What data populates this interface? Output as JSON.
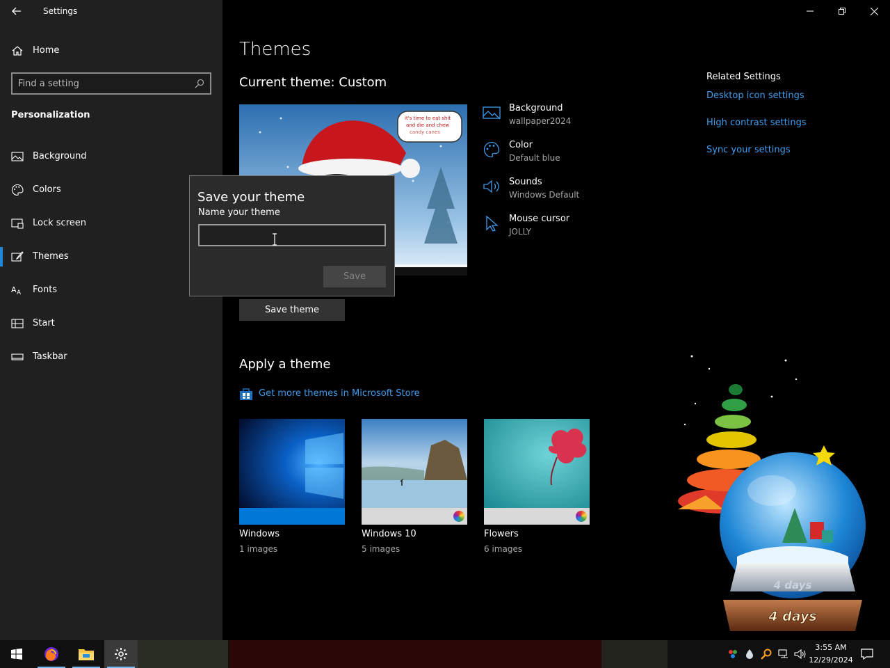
{
  "window": {
    "app_title": "Settings",
    "minimize_icon": "minimize-icon",
    "restore_icon": "restore-icon",
    "close_icon": "close-icon"
  },
  "sidebar": {
    "home_label": "Home",
    "search_placeholder": "Find a setting",
    "section_title": "Personalization",
    "items": [
      {
        "label": "Background",
        "icon": "picture-icon"
      },
      {
        "label": "Colors",
        "icon": "palette-icon"
      },
      {
        "label": "Lock screen",
        "icon": "lock-screen-icon"
      },
      {
        "label": "Themes",
        "icon": "brush-icon",
        "active": true
      },
      {
        "label": "Fonts",
        "icon": "fonts-icon"
      },
      {
        "label": "Start",
        "icon": "start-icon"
      },
      {
        "label": "Taskbar",
        "icon": "taskbar-icon"
      }
    ]
  },
  "main": {
    "title": "Themes",
    "current_theme": "Current theme: Custom",
    "preview_caption": "it's time to eat shit and die and chew candy canes",
    "save_theme_label": "Save theme",
    "properties": [
      {
        "title": "Background",
        "value": "wallpaper2024",
        "icon": "picture-icon"
      },
      {
        "title": "Color",
        "value": "Default blue",
        "icon": "palette-icon"
      },
      {
        "title": "Sounds",
        "value": "Windows Default",
        "icon": "speaker-icon"
      },
      {
        "title": "Mouse cursor",
        "value": "JOLLY",
        "icon": "pointer-icon"
      }
    ],
    "related": {
      "heading": "Related Settings",
      "links": [
        "Desktop icon settings",
        "High contrast settings",
        "Sync your settings"
      ]
    },
    "apply_title": "Apply a theme",
    "store_link": "Get more themes in Microsoft Store",
    "themes": [
      {
        "name": "Windows",
        "count": "1 images",
        "accent": "#0078d7"
      },
      {
        "name": "Windows 10",
        "count": "5 images",
        "accent": "#d9d9d9"
      },
      {
        "name": "Flowers",
        "count": "6 images",
        "accent": "#d9d9d9"
      }
    ]
  },
  "dialog": {
    "title": "Save your theme",
    "label": "Name your theme",
    "value": "",
    "save_label": "Save"
  },
  "gadget": {
    "countdown": "4 days",
    "countdown_small": "4 days"
  },
  "taskbar": {
    "time": "3:55 AM",
    "date": "12/29/2024",
    "apps": [
      "start-icon",
      "firefox-icon",
      "file-explorer-icon",
      "settings-icon"
    ]
  },
  "colors": {
    "accent": "#0078d7",
    "link": "#3e9cee",
    "sidebar_bg": "#202020",
    "main_bg": "#000000"
  }
}
